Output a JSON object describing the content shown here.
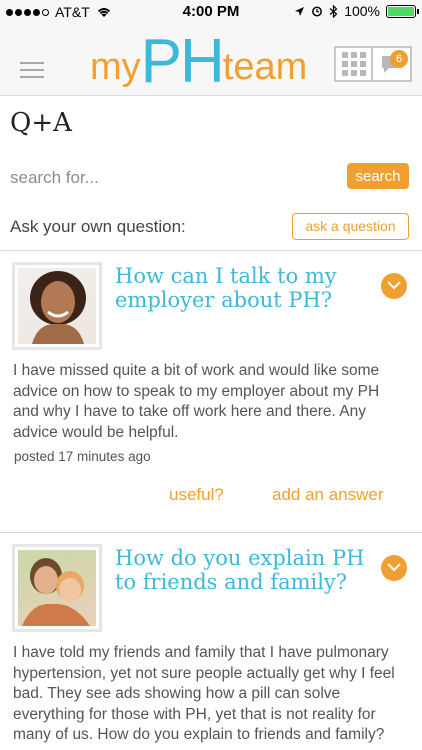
{
  "status_bar": {
    "carrier": "AT&T",
    "time": "4:00 PM",
    "battery": "100%"
  },
  "header": {
    "logo": {
      "my": "my",
      "ph": "PH",
      "team": "team"
    },
    "notification_count": "6"
  },
  "page": {
    "title": "Q+A"
  },
  "search": {
    "placeholder": "search for...",
    "button_label": "search"
  },
  "ask": {
    "label": "Ask your own question:",
    "button_label": "ask a question"
  },
  "questions": [
    {
      "title": "How can I talk to my employer about PH?",
      "body": "I have missed quite a bit of work and would like some advice on how to speak to my employer about my PH and why I have to take off work here and there. Any advice would be helpful.",
      "posted": "posted 17 minutes ago",
      "useful_label": "useful?",
      "answer_label": "add an answer"
    },
    {
      "title": "How do you explain PH to friends and family?",
      "body": "I have told my friends and family that I have pulmonary hypertension, yet not sure people actually get why I feel bad.  They see ads showing how a pill can solve everything for those with PH, yet that is not reality for many of us.  How do you explain to friends and family?"
    }
  ],
  "colors": {
    "accent_orange": "#f0a030",
    "accent_blue": "#3db8d9",
    "battery_green": "#4cd964"
  }
}
